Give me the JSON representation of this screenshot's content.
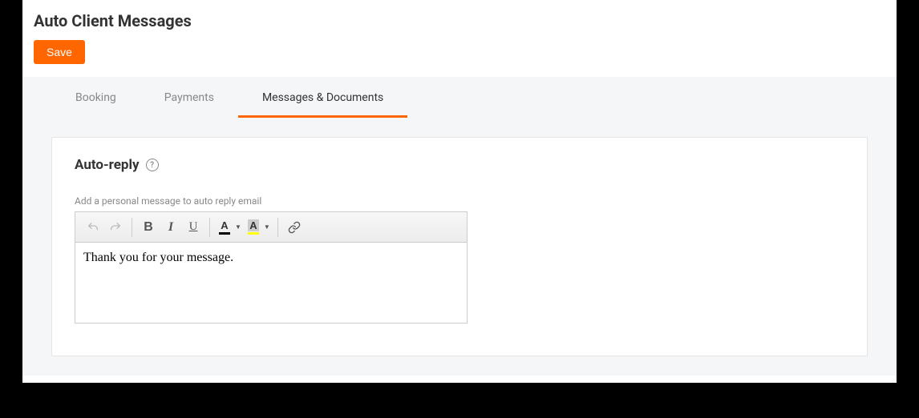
{
  "header": {
    "title": "Auto Client Messages",
    "save_label": "Save"
  },
  "tabs": [
    {
      "label": "Booking",
      "active": false
    },
    {
      "label": "Payments",
      "active": false
    },
    {
      "label": "Messages & Documents",
      "active": true
    }
  ],
  "section": {
    "title": "Auto-reply",
    "help_glyph": "?",
    "field_label": "Add a personal message to auto reply email",
    "editor_content": "Thank you for your message."
  },
  "toolbar": {
    "bold": "B",
    "italic": "I",
    "underline": "U",
    "text_color_letter": "A",
    "highlight_letter": "A",
    "caret": "▼"
  }
}
